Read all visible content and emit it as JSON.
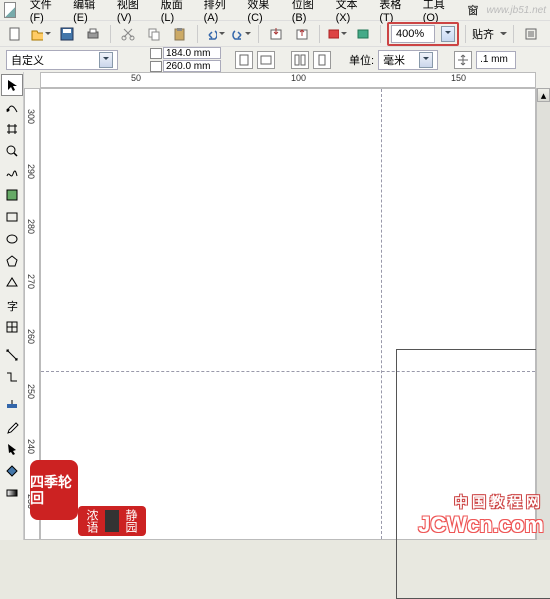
{
  "menu": {
    "file": "文件(F)",
    "edit": "编辑(E)",
    "view": "视图(V)",
    "layout": "版面(L)",
    "arrange": "排列(A)",
    "effects": "效果(C)",
    "bitmap": "位图(B)",
    "text": "文本(X)",
    "table": "表格(T)",
    "tools": "工具(O)",
    "window": "窗"
  },
  "watermark": "www.jb51.net",
  "toolbar1": {
    "zoom_value": "400%",
    "snap_label": "贴齐"
  },
  "propbar": {
    "preset": "自定义",
    "width": "184.0 mm",
    "height": "260.0 mm",
    "units_label": "单位:",
    "units_value": "毫米",
    "nudge": ".1 mm"
  },
  "ruler_h": [
    "50",
    "100",
    "150"
  ],
  "ruler_v": [
    "300",
    "290",
    "280",
    "270",
    "260",
    "250",
    "240",
    "230"
  ],
  "seal1": "四季轮回",
  "seal2a": "浓语",
  "seal2b": "静园",
  "brand_cn": "中国教程网",
  "brand_en": "JCWcn.com"
}
